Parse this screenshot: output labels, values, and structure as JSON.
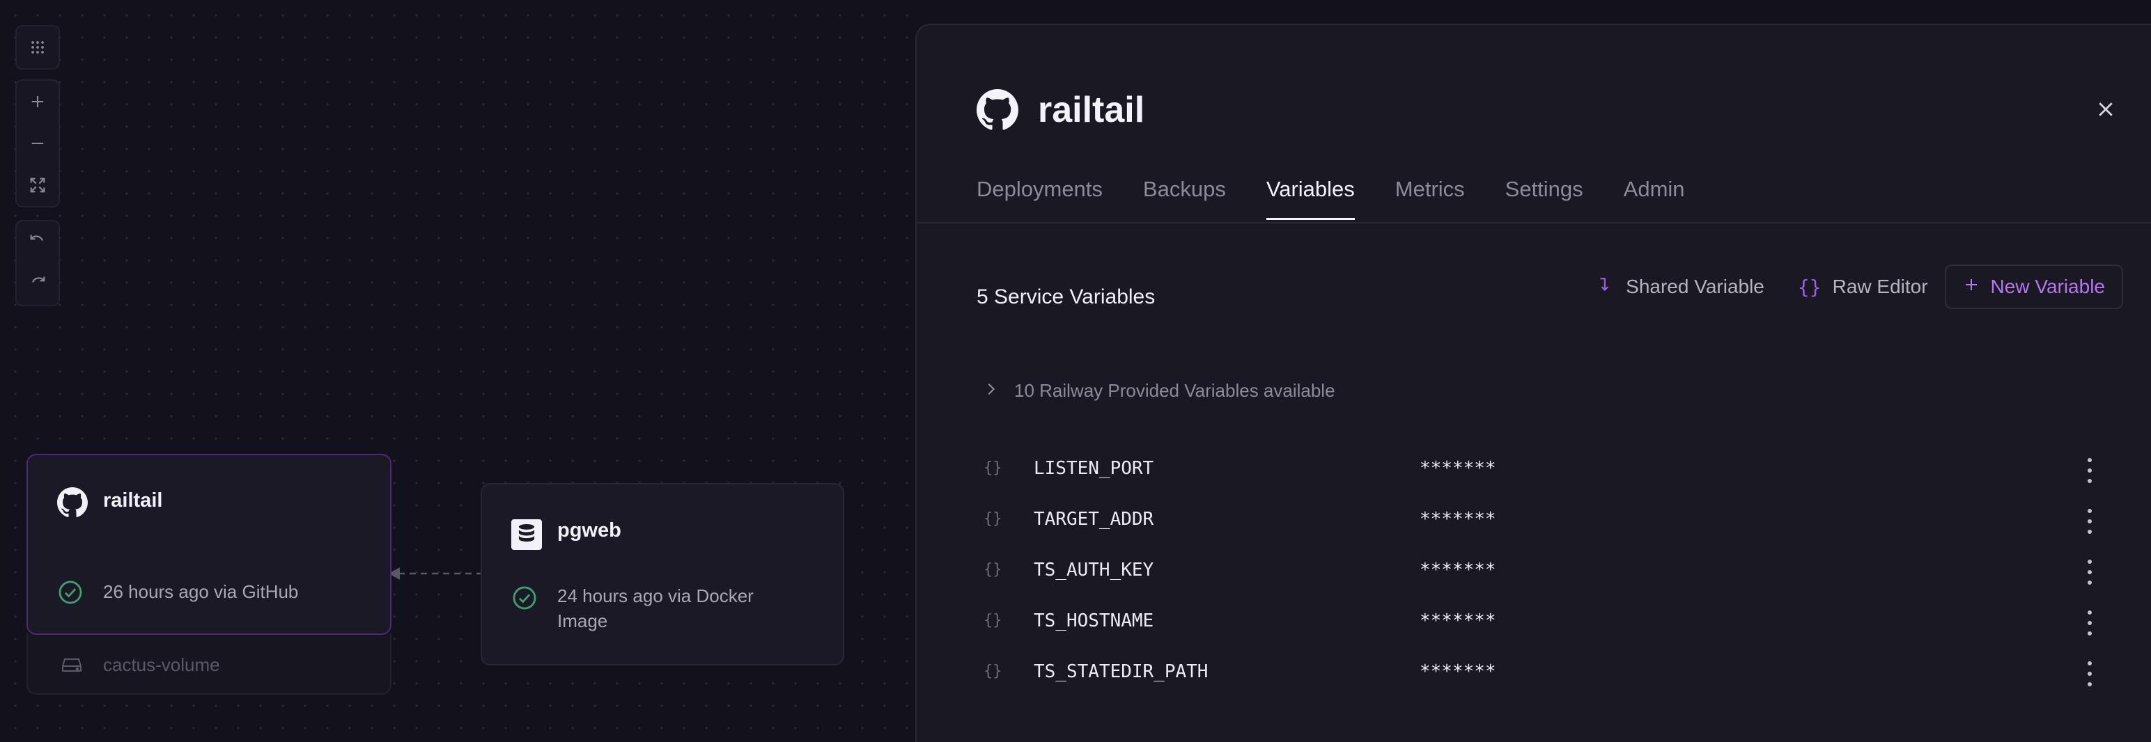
{
  "canvas": {
    "nodes": [
      {
        "title": "railtail",
        "icon": "github-icon",
        "status": "26 hours ago via GitHub"
      },
      {
        "title": "pgweb",
        "icon": "database-icon",
        "status": "24 hours ago via Docker Image"
      }
    ],
    "volume": {
      "label": "cactus-volume"
    }
  },
  "panel": {
    "title": "railtail",
    "tabs": [
      {
        "label": "Deployments"
      },
      {
        "label": "Backups"
      },
      {
        "label": "Variables"
      },
      {
        "label": "Metrics"
      },
      {
        "label": "Settings"
      },
      {
        "label": "Admin"
      }
    ],
    "active_tab": "Variables",
    "variables_heading": "5 Service Variables",
    "actions": {
      "shared": "Shared Variable",
      "raw": "Raw Editor",
      "new": "New Variable"
    },
    "provided": "10 Railway Provided Variables available",
    "variables": [
      {
        "brace": "{}",
        "name": "LISTEN_PORT",
        "value": "*******"
      },
      {
        "brace": "{}",
        "name": "TARGET_ADDR",
        "value": "*******"
      },
      {
        "brace": "{}",
        "name": "TS_AUTH_KEY",
        "value": "*******"
      },
      {
        "brace": "{}",
        "name": "TS_HOSTNAME",
        "value": "*******"
      },
      {
        "brace": "{}",
        "name": "TS_STATEDIR_PATH",
        "value": "*******"
      }
    ]
  },
  "colors": {
    "accent": "#b577f0",
    "success": "#3f9f6e",
    "background": "#13111c",
    "panel": "#1a1823"
  }
}
